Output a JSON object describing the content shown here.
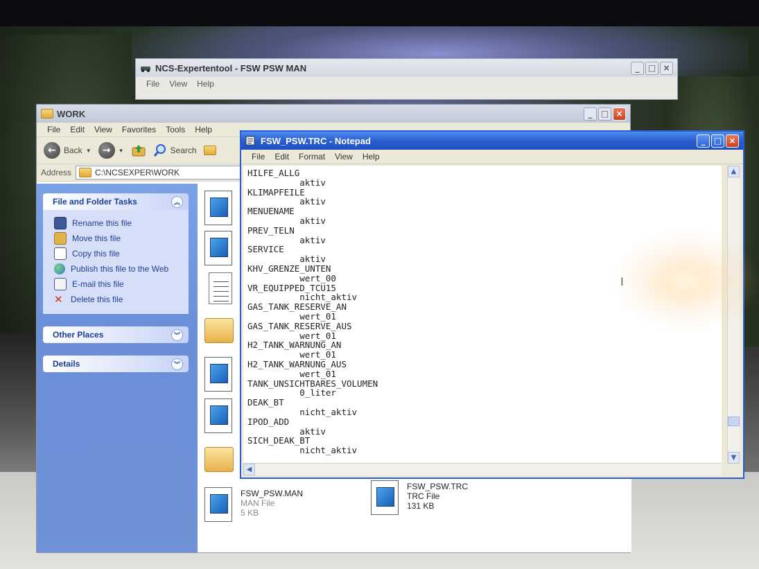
{
  "ncs_window": {
    "title": "NCS-Expertentool - FSW PSW MAN",
    "menu": [
      "File",
      "View",
      "Help"
    ]
  },
  "explorer": {
    "title": "WORK",
    "menu": [
      "File",
      "Edit",
      "View",
      "Favorites",
      "Tools",
      "Help"
    ],
    "toolbar": {
      "back": "Back",
      "search": "Search"
    },
    "address_label": "Address",
    "address_value": "C:\\NCSEXPER\\WORK",
    "tasks_panel": {
      "title": "File and Folder Tasks",
      "items": [
        {
          "label": "Rename this file",
          "icon": "rename-icon"
        },
        {
          "label": "Move this file",
          "icon": "move-icon"
        },
        {
          "label": "Copy this file",
          "icon": "copy-icon"
        },
        {
          "label": "Publish this file to the Web",
          "icon": "globe-icon"
        },
        {
          "label": "E-mail this file",
          "icon": "email-icon"
        },
        {
          "label": "Delete this file",
          "icon": "delete-icon"
        }
      ]
    },
    "other_places": {
      "title": "Other Places"
    },
    "details": {
      "title": "Details"
    },
    "files": [
      {
        "name": "FSW_PSW.MAN",
        "type": "MAN File",
        "size": "5 KB"
      },
      {
        "name": "FSW_PSW.TRC",
        "type": "TRC File",
        "size": "131 KB"
      }
    ]
  },
  "notepad": {
    "title": "FSW_PSW.TRC - Notepad",
    "menu": [
      "File",
      "Edit",
      "Format",
      "View",
      "Help"
    ],
    "lines": [
      "HILFE_ALLG",
      "          aktiv",
      "KLIMAPFEILE",
      "          aktiv",
      "MENUENAME",
      "          aktiv",
      "PREV_TELN",
      "          aktiv",
      "SERVICE",
      "          aktiv",
      "KHV_GRENZE_UNTEN",
      "          wert_00",
      "VR_EQUIPPED_TCU15",
      "          nicht_aktiv",
      "GAS_TANK_RESERVE_AN",
      "          wert_01",
      "GAS_TANK_RESERVE_AUS",
      "          wert_01",
      "H2_TANK_WARNUNG_AN",
      "          wert_01",
      "H2_TANK_WARNUNG_AUS",
      "          wert_01",
      "TANK_UNSICHTBARES_VOLUMEN",
      "          0_liter",
      "DEAK_BT",
      "          nicht_aktiv",
      "IPOD_ADD",
      "          aktiv",
      "SICH_DEAK_BT",
      "          nicht_aktiv"
    ]
  },
  "colors": {
    "xp_blue": "#2a5fd1",
    "taskpane_blue": "#6f91d6",
    "window_face": "#ece9d8"
  }
}
